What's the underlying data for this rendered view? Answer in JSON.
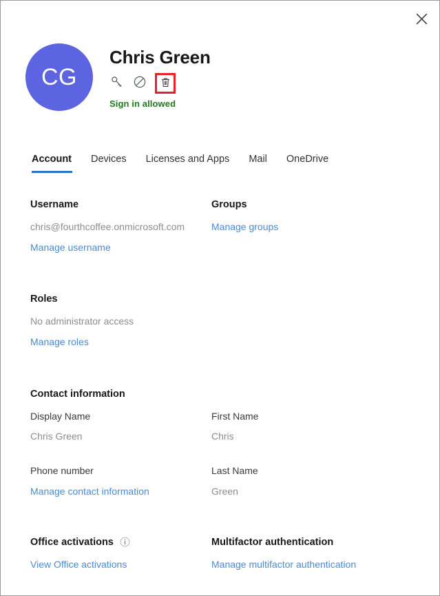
{
  "panel": {
    "close_label": "Close",
    "accent_blue": "#2a6fc9",
    "link_blue": "#4a8ad4",
    "avatar_color": "#5c64e2",
    "status_green": "#1f7a1f",
    "highlight_red": "#e8202a"
  },
  "header": {
    "avatar_initials": "CG",
    "user_name": "Chris Green",
    "signin_status": "Sign in allowed",
    "actions": [
      {
        "name": "reset-password-icon",
        "tooltip": "Reset password"
      },
      {
        "name": "block-signin-icon",
        "tooltip": "Block sign-in"
      },
      {
        "name": "delete-user-icon",
        "tooltip": "Delete user",
        "highlighted": true
      }
    ]
  },
  "tabs": [
    {
      "label": "Account",
      "active": true
    },
    {
      "label": "Devices",
      "active": false
    },
    {
      "label": "Licenses and Apps",
      "active": false
    },
    {
      "label": "Mail",
      "active": false
    },
    {
      "label": "OneDrive",
      "active": false
    }
  ],
  "sections": {
    "username": {
      "title": "Username",
      "value": "chris@fourthcoffee.onmicrosoft.com",
      "link": "Manage username"
    },
    "groups": {
      "title": "Groups",
      "link": "Manage groups"
    },
    "roles": {
      "title": "Roles",
      "value": "No administrator access",
      "link": "Manage roles"
    },
    "contact": {
      "title": "Contact information",
      "display_name_label": "Display Name",
      "display_name_value": "Chris Green",
      "first_name_label": "First Name",
      "first_name_value": "Chris",
      "phone_label": "Phone number",
      "last_name_label": "Last Name",
      "last_name_value": "Green",
      "link": "Manage contact information"
    },
    "office": {
      "title": "Office activations",
      "info_icon": "info-icon",
      "link": "View Office activations"
    },
    "mfa": {
      "title": "Multifactor authentication",
      "link": "Manage multifactor authentication"
    }
  }
}
